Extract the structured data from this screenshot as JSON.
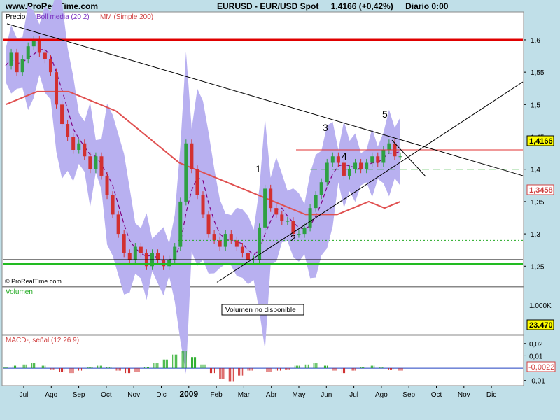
{
  "header": {
    "site": "www.ProRealTime.com",
    "symbol": "EURUSD - EUR/USD Spot",
    "price_change": "1,4166 (+0,42%)",
    "period": "Diario  0:00"
  },
  "colors": {
    "background": "#c0dfe8",
    "panel": "#ffffff",
    "candle_up": "#2ea043",
    "candle_down": "#d23030",
    "bollinger_band": "#b8b0f0",
    "bollinger_mid": "#800080",
    "sma200": "#e05050",
    "macd_pos": "#22aa22",
    "macd_neg": "#cc2222"
  },
  "chart_data": [
    {
      "type": "line",
      "panel": "price",
      "legend": [
        "Precio",
        "Boll media (20 2)",
        "MM (Simple 200)"
      ],
      "y_ticks": [
        "1,6",
        "1,55",
        "1,5",
        "1,45",
        "1,4",
        "1,35",
        "1,3",
        "1,25"
      ],
      "ylim": [
        1.22,
        1.64
      ],
      "x_months": [
        "Jul",
        "Ago",
        "Sep",
        "Oct",
        "Nov",
        "Dic",
        "2009",
        "Feb",
        "Mar",
        "Abr",
        "May",
        "Jun",
        "Jul",
        "Ago",
        "Sep",
        "Oct",
        "Nov",
        "Dic"
      ],
      "price_labels": {
        "last": "1,4166",
        "sma200": "1,3458"
      },
      "close_series": [
        1.56,
        1.58,
        1.55,
        1.57,
        1.59,
        1.6,
        1.58,
        1.57,
        1.55,
        1.5,
        1.47,
        1.45,
        1.43,
        1.44,
        1.42,
        1.4,
        1.42,
        1.39,
        1.36,
        1.33,
        1.3,
        1.27,
        1.26,
        1.28,
        1.27,
        1.25,
        1.27,
        1.26,
        1.25,
        1.26,
        1.28,
        1.35,
        1.44,
        1.4,
        1.36,
        1.33,
        1.3,
        1.29,
        1.28,
        1.3,
        1.29,
        1.28,
        1.27,
        1.26,
        1.26,
        1.31,
        1.37,
        1.34,
        1.33,
        1.32,
        1.32,
        1.3,
        1.3,
        1.31,
        1.34,
        1.36,
        1.38,
        1.41,
        1.42,
        1.41,
        1.39,
        1.4,
        1.41,
        1.4,
        1.41,
        1.42,
        1.41,
        1.43,
        1.44,
        1.42,
        1.42
      ],
      "sma200_series": [
        1.5,
        1.51,
        1.52,
        1.52,
        1.52,
        1.51,
        1.5,
        1.49,
        1.47,
        1.45,
        1.43,
        1.41,
        1.4,
        1.39,
        1.38,
        1.37,
        1.36,
        1.35,
        1.34,
        1.33,
        1.33,
        1.33,
        1.34,
        1.35,
        1.34,
        1.35
      ],
      "horizontal_levels": [
        {
          "value": 1.6,
          "color": "#e00000",
          "style": "thick"
        },
        {
          "value": 1.43,
          "color": "#e03030",
          "style": "solid"
        },
        {
          "value": 1.4,
          "color": "#22aa22",
          "style": "dashed"
        },
        {
          "value": 1.29,
          "color": "#22aa22",
          "style": "dotted"
        },
        {
          "value": 1.26,
          "color": "#000000",
          "style": "solid"
        },
        {
          "value": 1.253,
          "color": "#22bb22",
          "style": "thick"
        }
      ],
      "wave_labels": [
        "1",
        "2",
        "3",
        "4",
        "5"
      ],
      "footer": "© ProRealTime.com"
    },
    {
      "type": "bar",
      "panel": "volume",
      "title": "Volumen",
      "y_tick": "1.000K",
      "last_value": "23.470",
      "notice": "Volumen no disponible"
    },
    {
      "type": "bar",
      "panel": "macd",
      "title": "MACD-, señal (12 26 9)",
      "y_ticks": [
        "0,02",
        "0,01",
        "-0,01"
      ],
      "ylim": [
        -0.013,
        0.025
      ],
      "last_value": "-0,0022",
      "values": [
        0.001,
        0.002,
        0.003,
        0.004,
        0.002,
        -0.001,
        -0.003,
        -0.004,
        -0.002,
        0.001,
        0.002,
        0.001,
        -0.002,
        -0.004,
        -0.003,
        0.001,
        0.004,
        0.007,
        0.011,
        0.014,
        0.009,
        0.003,
        -0.004,
        -0.009,
        -0.011,
        -0.006,
        -0.002,
        0.0,
        -0.003,
        -0.002,
        -0.001,
        0.002,
        0.003,
        0.004,
        0.002,
        -0.002,
        -0.004,
        -0.002,
        0.001,
        0.002,
        0.001,
        -0.001,
        -0.002
      ]
    }
  ]
}
